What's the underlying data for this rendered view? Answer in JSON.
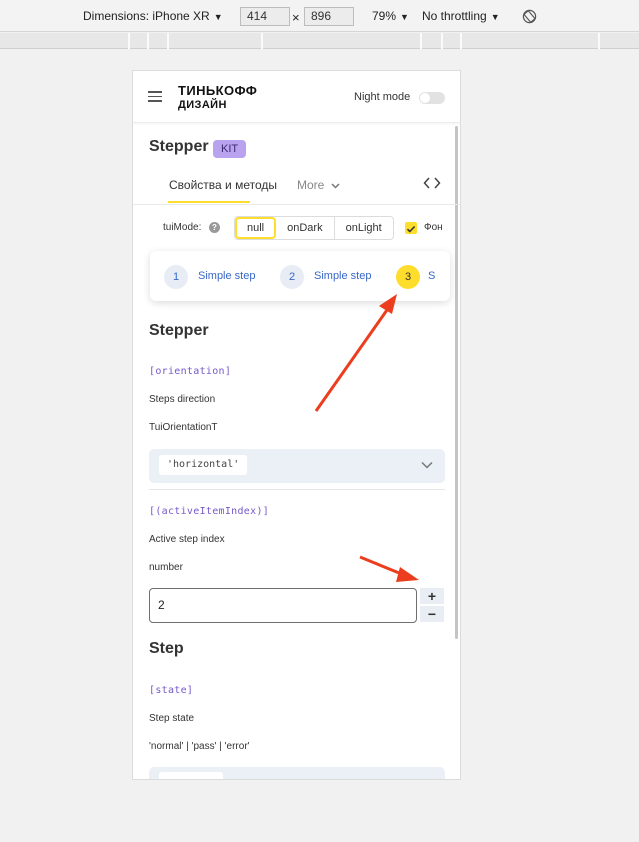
{
  "devtools": {
    "dimensions_label": "Dimensions: iPhone XR",
    "width": "414",
    "height": "896",
    "times": "×",
    "zoom": "79%",
    "throttling": "No throttling"
  },
  "header": {
    "logo_line1": "ТИНЬКОФФ",
    "logo_line2": "ДИЗАЙН",
    "night_mode": "Night mode"
  },
  "page": {
    "title": "Stepper",
    "badge": "KIT",
    "tabs": [
      {
        "label": "Свойства и методы"
      },
      {
        "label": "More"
      }
    ]
  },
  "controls": {
    "mode_label": "tuiMode:",
    "mode_options": [
      "null",
      "onDark",
      "onLight"
    ],
    "selected_mode": "null",
    "background_label": "Фон"
  },
  "demo": {
    "steps": [
      {
        "number": "1",
        "label": "Simple step"
      },
      {
        "number": "2",
        "label": "Simple step"
      },
      {
        "number": "3",
        "label": "S"
      }
    ]
  },
  "stepper_section": {
    "heading": "Stepper",
    "orientation": {
      "name": "[orientation]",
      "description": "Steps direction",
      "type": "TuiOrientationT",
      "value": "'horizontal'"
    },
    "active_index": {
      "name": "[(activeItemIndex)]",
      "description": "Active step index",
      "type": "number",
      "value": "2",
      "plus": "+",
      "minus": "−"
    }
  },
  "step_section": {
    "heading": "Step",
    "state": {
      "name": "[state]",
      "description": "Step state",
      "type": "'normal' | 'pass' | 'error'"
    }
  },
  "colors": {
    "accent_yellow": "#ffdd2d",
    "kit_badge": "#b9a3ef",
    "link_blue": "#3867c6",
    "annotation_red": "#ec3d1f"
  }
}
